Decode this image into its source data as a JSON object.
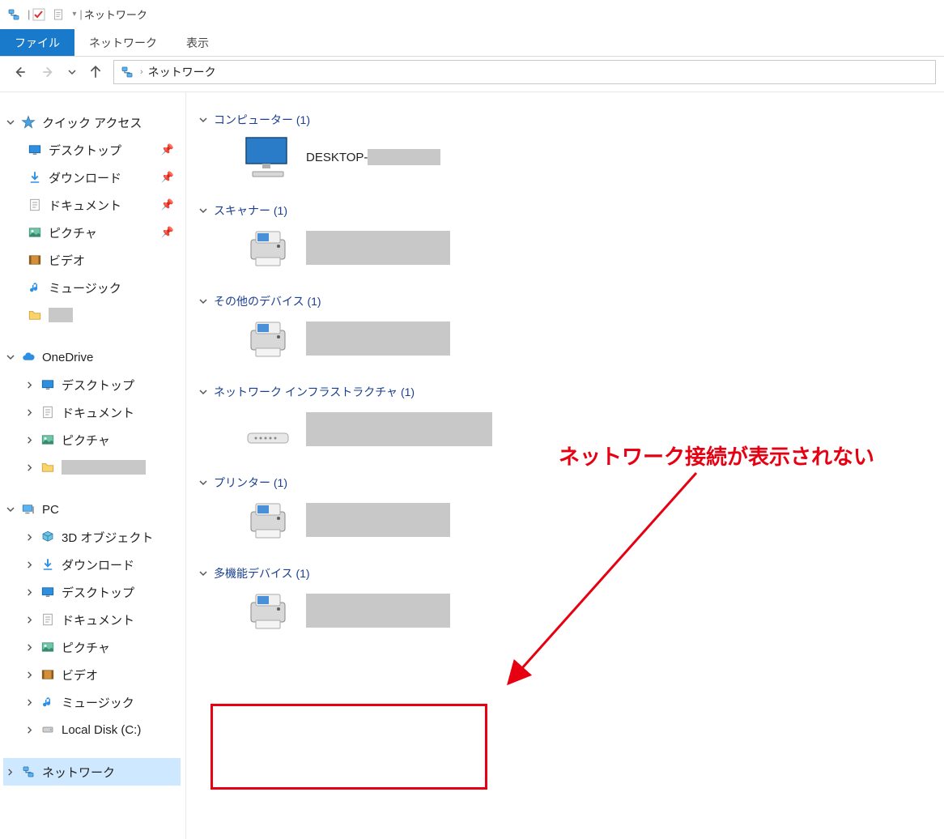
{
  "title": "ネットワーク",
  "ribbon": {
    "file": "ファイル",
    "network": "ネットワーク",
    "view": "表示"
  },
  "address": "ネットワーク",
  "tree": {
    "quick_access": "クイック アクセス",
    "quick_items": [
      "デスクトップ",
      "ダウンロード",
      "ドキュメント",
      "ピクチャ",
      "ビデオ",
      "ミュージック",
      ""
    ],
    "onedrive": "OneDrive",
    "onedrive_items": [
      "デスクトップ",
      "ドキュメント",
      "ピクチャ",
      ""
    ],
    "pc": "PC",
    "pc_items": [
      "3D オブジェクト",
      "ダウンロード",
      "デスクトップ",
      "ドキュメント",
      "ピクチャ",
      "ビデオ",
      "ミュージック",
      "Local Disk (C:)"
    ],
    "network": "ネットワーク"
  },
  "categories": [
    {
      "label": "コンピューター (1)",
      "device": "DESKTOP-",
      "icon": "monitor",
      "redact": "sm",
      "show_text": true,
      "text_redact": true
    },
    {
      "label": "スキャナー (1)",
      "device": "",
      "icon": "printer",
      "redact": "md"
    },
    {
      "label": "その他のデバイス (1)",
      "device": "",
      "icon": "printer",
      "redact": "md"
    },
    {
      "label": "ネットワーク インフラストラクチャ (1)",
      "device": "",
      "icon": "router",
      "redact": "lg"
    },
    {
      "label": "プリンター (1)",
      "device": "",
      "icon": "printer",
      "redact": "md"
    },
    {
      "label": "多機能デバイス (1)",
      "device": "",
      "icon": "printer",
      "redact": "md"
    }
  ],
  "annotation": "ネットワーク接続が表示されない"
}
